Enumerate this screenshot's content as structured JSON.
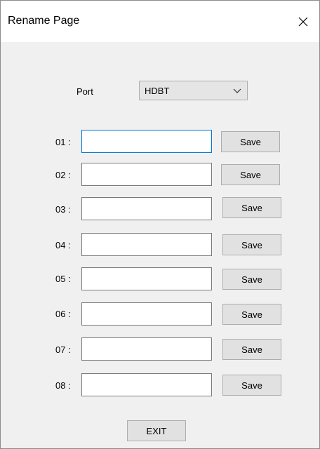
{
  "window": {
    "title": "Rename Page",
    "close_icon": "close-icon"
  },
  "port": {
    "label": "Port",
    "selected": "HDBT",
    "dropdown_icon": "chevron-down-icon"
  },
  "rows": [
    {
      "label": "01 :",
      "value": "",
      "save_label": "Save"
    },
    {
      "label": "02 :",
      "value": "",
      "save_label": "Save"
    },
    {
      "label": "03 :",
      "value": "",
      "save_label": "Save"
    },
    {
      "label": "04 :",
      "value": "",
      "save_label": "Save"
    },
    {
      "label": "05 :",
      "value": "",
      "save_label": "Save"
    },
    {
      "label": "06 :",
      "value": "",
      "save_label": "Save"
    },
    {
      "label": "07 :",
      "value": "",
      "save_label": "Save"
    },
    {
      "label": "08 :",
      "value": "",
      "save_label": "Save"
    }
  ],
  "exit_label": "EXIT",
  "colors": {
    "title_bar": "#ffffff",
    "background": "#f0f0f0",
    "focus_border": "#0078d7",
    "button_face": "#e1e1e1"
  }
}
